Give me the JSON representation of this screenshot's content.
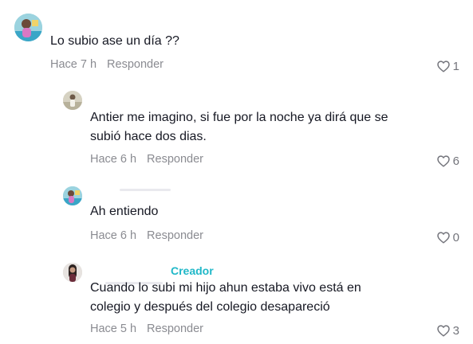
{
  "comments": [
    {
      "text": "Lo subio ase un día ??",
      "time": "Hace 7 h",
      "reply_label": "Responder",
      "likes": "1"
    },
    {
      "text": "Antier me imagino, si fue por la noche ya dirá que se\nsubió hace dos dias.",
      "time": "Hace 6 h",
      "reply_label": "Responder",
      "likes": "6"
    },
    {
      "text": "Ah entiendo",
      "time": "Hace 6 h",
      "reply_label": "Responder",
      "likes": "0"
    },
    {
      "creator_badge": "Creador",
      "text": "Cuando lo subi mi hijo ahun estaba vivo está en\ncolegio y después del colegio desapareció",
      "time": "Hace 5 h",
      "reply_label": "Responder",
      "likes": "3"
    }
  ],
  "colors": {
    "creator_badge": "#20b8c8",
    "meta_text": "#8a8b91",
    "body_text": "#161823"
  },
  "icons": {
    "like": "heart-outline-icon"
  }
}
